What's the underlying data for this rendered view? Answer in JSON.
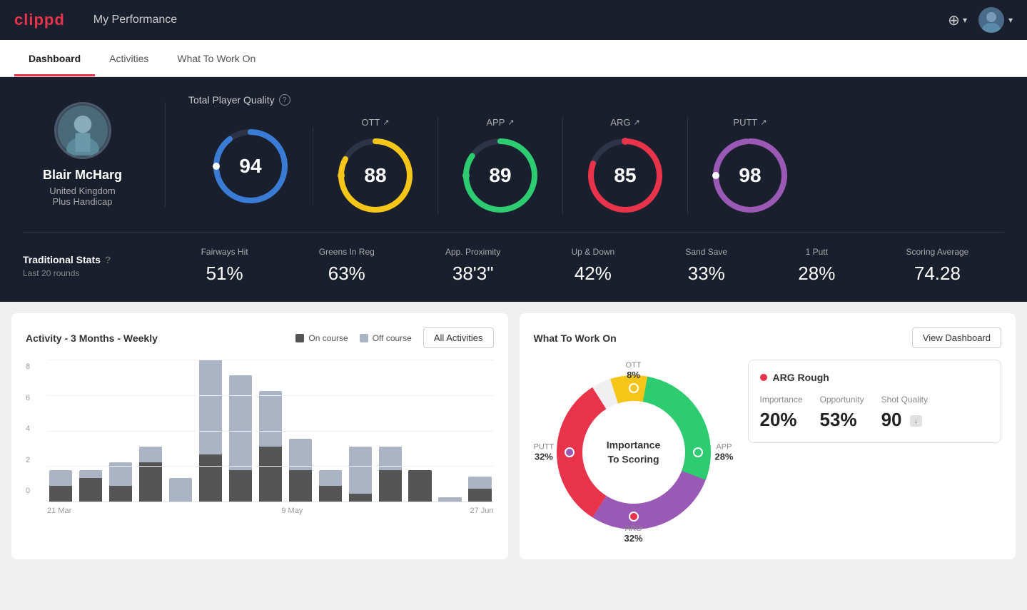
{
  "app": {
    "logo": "clippd",
    "header_title": "My Performance",
    "add_btn_label": "+",
    "avatar_alt": "user avatar"
  },
  "tabs": [
    {
      "id": "dashboard",
      "label": "Dashboard",
      "active": true
    },
    {
      "id": "activities",
      "label": "Activities",
      "active": false
    },
    {
      "id": "what-to-work-on",
      "label": "What To Work On",
      "active": false
    }
  ],
  "player": {
    "name": "Blair McHarg",
    "country": "United Kingdom",
    "handicap": "Plus Handicap"
  },
  "quality": {
    "title": "Total Player Quality",
    "main_score": "94",
    "main_color": "#3a7bd5",
    "categories": [
      {
        "id": "ott",
        "label": "OTT",
        "score": "88",
        "color": "#f5c518",
        "arrow": "↗"
      },
      {
        "id": "app",
        "label": "APP",
        "score": "89",
        "color": "#2ecc71",
        "arrow": "↗"
      },
      {
        "id": "arg",
        "label": "ARG",
        "score": "85",
        "color": "#e8334a",
        "arrow": "↗"
      },
      {
        "id": "putt",
        "label": "PUTT",
        "score": "98",
        "color": "#9b59b6",
        "arrow": "↗"
      }
    ]
  },
  "stats": {
    "title": "Traditional Stats",
    "subtitle": "Last 20 rounds",
    "items": [
      {
        "id": "fairways-hit",
        "name": "Fairways Hit",
        "value": "51%"
      },
      {
        "id": "greens-in-reg",
        "name": "Greens In Reg",
        "value": "63%"
      },
      {
        "id": "app-proximity",
        "name": "App. Proximity",
        "value": "38'3\""
      },
      {
        "id": "up-down",
        "name": "Up & Down",
        "value": "42%"
      },
      {
        "id": "sand-save",
        "name": "Sand Save",
        "value": "33%"
      },
      {
        "id": "one-putt",
        "name": "1 Putt",
        "value": "28%"
      },
      {
        "id": "scoring-average",
        "name": "Scoring Average",
        "value": "74.28"
      }
    ]
  },
  "activity_chart": {
    "title": "Activity - 3 Months - Weekly",
    "legend": {
      "on_course_label": "On course",
      "off_course_label": "Off course",
      "on_course_color": "#555",
      "off_course_color": "#aab4c4"
    },
    "all_activities_btn": "All Activities",
    "grid_labels": [
      "8",
      "6",
      "4",
      "2",
      "0"
    ],
    "x_labels": [
      "21 Mar",
      "9 May",
      "27 Jun"
    ],
    "bars": [
      {
        "on": 1,
        "off": 1
      },
      {
        "on": 1.5,
        "off": 0.5
      },
      {
        "on": 1,
        "off": 1.5
      },
      {
        "on": 2.5,
        "off": 1
      },
      {
        "on": 0,
        "off": 1.5
      },
      {
        "on": 3,
        "off": 6
      },
      {
        "on": 2,
        "off": 6
      },
      {
        "on": 3.5,
        "off": 3.5
      },
      {
        "on": 2,
        "off": 2
      },
      {
        "on": 1,
        "off": 1
      },
      {
        "on": 0.5,
        "off": 3
      },
      {
        "on": 2,
        "off": 1.5
      },
      {
        "on": 2,
        "off": 0
      },
      {
        "on": 0,
        "off": 0.5
      },
      {
        "on": 0.8,
        "off": 0.8
      }
    ]
  },
  "what_to_work_on": {
    "title": "What To Work On",
    "view_dashboard_btn": "View Dashboard",
    "donut_center_line1": "Importance",
    "donut_center_line2": "To Scoring",
    "segments": [
      {
        "id": "ott",
        "label": "OTT",
        "percent": "8%",
        "color": "#f5c518",
        "position": "top"
      },
      {
        "id": "app",
        "label": "APP",
        "percent": "28%",
        "color": "#2ecc71",
        "position": "right"
      },
      {
        "id": "arg",
        "label": "ARG",
        "percent": "32%",
        "color": "#e8334a",
        "position": "bottom"
      },
      {
        "id": "putt",
        "label": "PUTT",
        "percent": "32%",
        "color": "#9b59b6",
        "position": "left"
      }
    ],
    "detail_card": {
      "title": "ARG Rough",
      "metrics": [
        {
          "id": "importance",
          "label": "Importance",
          "value": "20%"
        },
        {
          "id": "opportunity",
          "label": "Opportunity",
          "value": "53%"
        },
        {
          "id": "shot-quality",
          "label": "Shot Quality",
          "value": "90",
          "badge": "↓"
        }
      ]
    }
  }
}
